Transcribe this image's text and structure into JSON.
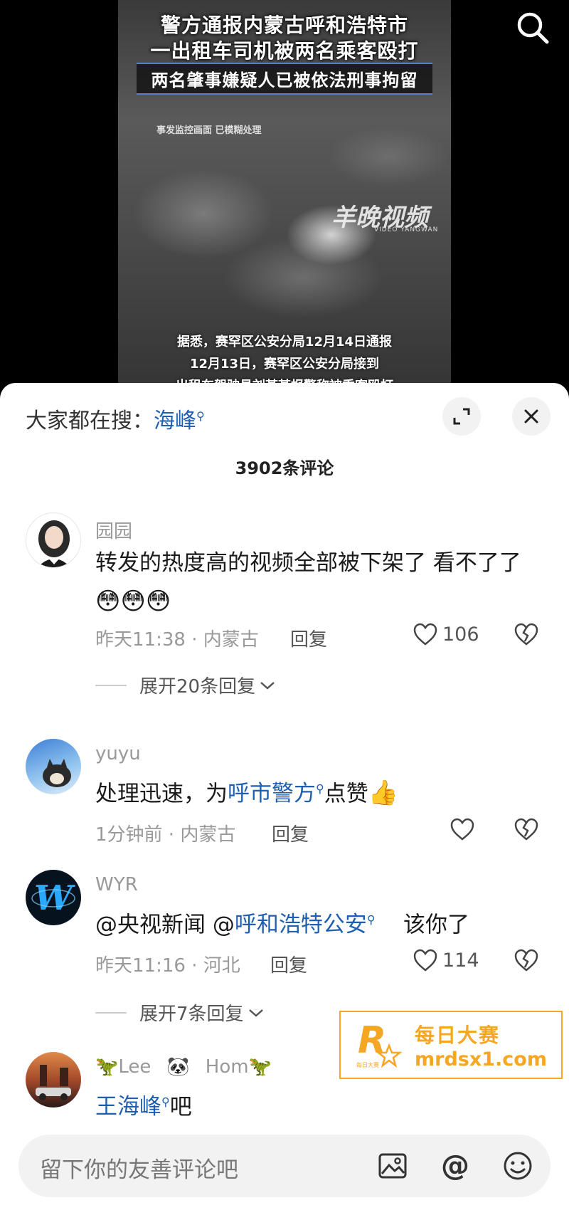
{
  "video": {
    "headline_1": "警方通报内蒙古呼和浩特市",
    "headline_2": "一出租车司机被两名乘客殴打",
    "headline_3": "两名肇事嫌疑人已被依法刑事拘留",
    "cctv_note": "事发监控画面 已模糊处理",
    "watermark_brand": "羊晚视频",
    "watermark_sub": "VIDEO YANGWAN",
    "caption_1": "据悉，赛罕区公安分局12月14日通报",
    "caption_2": "12月13日，赛罕区公安分局接到",
    "caption_3": "出租车驾驶员刘某某报警称被乘客殴打",
    "search_icon": "search-icon"
  },
  "sheet": {
    "trending_label": "大家都在搜：",
    "trending_term": "海峰",
    "comment_count": "3902条评论",
    "icons": {
      "expand": "expand-icon",
      "close": "close-icon"
    }
  },
  "comments": [
    {
      "username": "园园",
      "content": "转发的热度高的视频全部被下架了  看不了了",
      "emojis": "😳😳😳",
      "meta": "昨天11:38 · 内蒙古",
      "reply_label": "回复",
      "likes": "106",
      "expand_replies": "展开20条回复"
    },
    {
      "username": "yuyu",
      "content_prefix": "处理迅速，为",
      "content_link": "呼市警方",
      "content_suffix": "点赞",
      "emoji": "👍",
      "meta": "1分钟前 · 内蒙古",
      "reply_label": "回复",
      "likes": ""
    },
    {
      "username": "WYR",
      "content_prefix": "@央视新闻 @",
      "content_link": "呼和浩特公安",
      "content_suffix": "    该你了",
      "meta": "昨天11:16 · 河北",
      "reply_label": "回复",
      "likes": "114",
      "expand_replies": "展开7条回复"
    },
    {
      "username_prefix": "🦖Lee",
      "username_mid": "🐼",
      "username_suffix": "Hom🦖",
      "content_link": "王海峰",
      "content_suffix": "吧"
    }
  ],
  "promo": {
    "line1": "每日大赛",
    "line2": "mrdsx1.com",
    "logo_letter": "R",
    "logo_small": "每日大赛",
    "accent": "#f5a623"
  },
  "input": {
    "placeholder": "留下你的友善评论吧",
    "icons": [
      "image-icon",
      "at-icon",
      "emoji-icon"
    ],
    "at_symbol": "@"
  },
  "colors": {
    "link": "#1f5fb0",
    "meta": "#999999",
    "sheet_bg": "#ffffff"
  }
}
